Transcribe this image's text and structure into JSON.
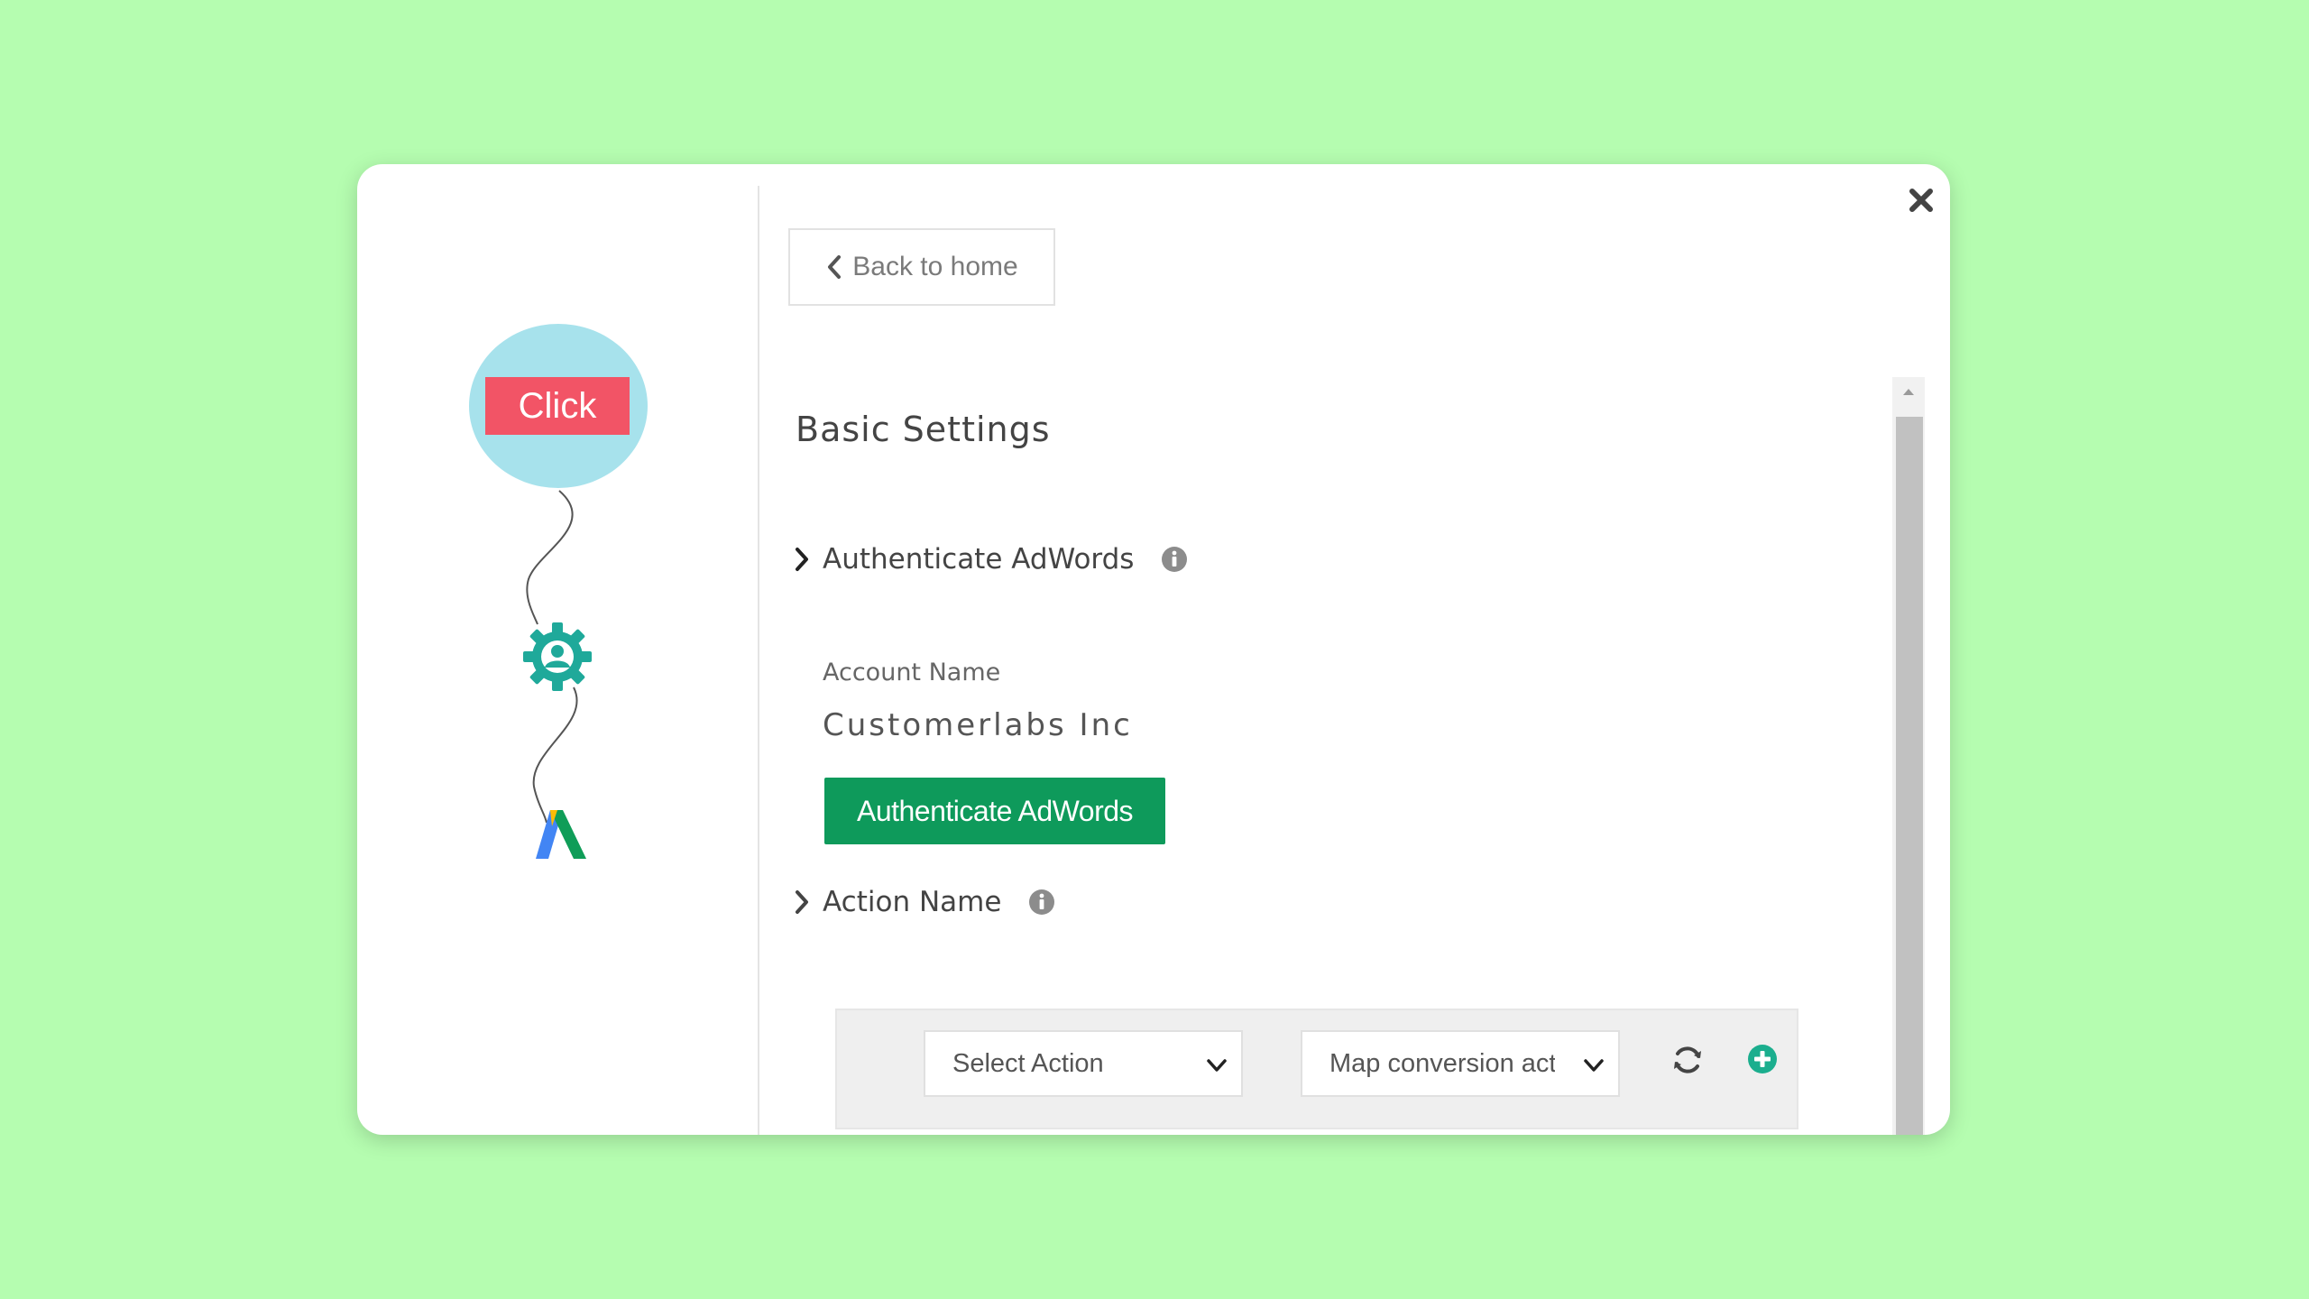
{
  "flow": {
    "click_label": "Click",
    "gear_icon": "gear-user-icon",
    "adwords_icon": "google-adwords-logo"
  },
  "header": {
    "back_label": "Back to home",
    "close_icon": "close-icon"
  },
  "settings": {
    "title": "Basic Settings",
    "authenticate": {
      "section_label": "Authenticate AdWords",
      "account_label": "Account Name",
      "account_value": "Customerlabs Inc",
      "button_label": "Authenticate AdWords"
    },
    "action": {
      "section_label": "Action Name",
      "select_action": "Select Action",
      "map_conversion": "Map conversion acti"
    }
  },
  "colors": {
    "background": "#b5fdb0",
    "click_circle": "#a7e2ec",
    "click_label": "#f25466",
    "primary_button": "#0e9a5b",
    "gear": "#1fa99a"
  }
}
